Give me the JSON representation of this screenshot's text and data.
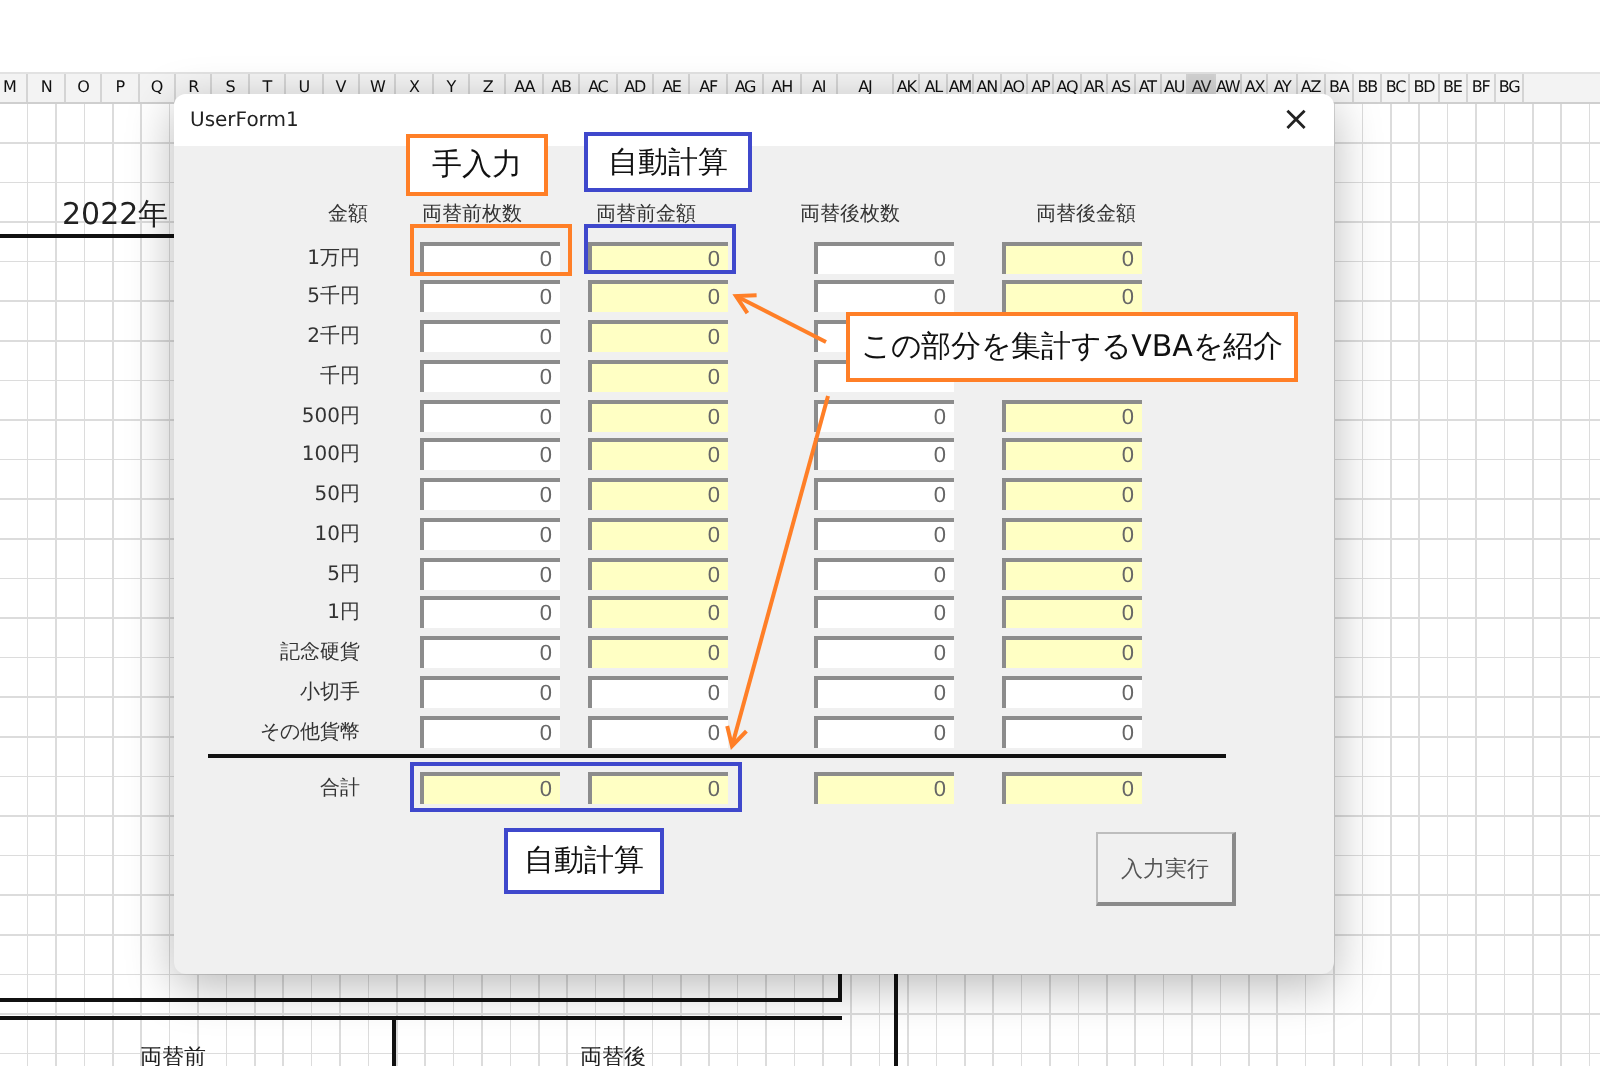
{
  "sheet": {
    "columns": [
      {
        "label": "M",
        "selected": false
      },
      {
        "label": "N",
        "selected": false
      },
      {
        "label": "O",
        "selected": false
      },
      {
        "label": "P",
        "selected": false
      },
      {
        "label": "Q",
        "selected": false
      },
      {
        "label": "R",
        "selected": false
      },
      {
        "label": "S",
        "selected": false
      },
      {
        "label": "T",
        "selected": false
      },
      {
        "label": "U",
        "selected": false
      },
      {
        "label": "V",
        "selected": false
      },
      {
        "label": "W",
        "selected": false
      },
      {
        "label": "X",
        "selected": false
      },
      {
        "label": "Y",
        "selected": false
      },
      {
        "label": "Z",
        "selected": false
      },
      {
        "label": "AA",
        "selected": false
      },
      {
        "label": "AB",
        "selected": false
      },
      {
        "label": "AC",
        "selected": false
      },
      {
        "label": "AD",
        "selected": false
      },
      {
        "label": "AE",
        "selected": false
      },
      {
        "label": "AF",
        "selected": false
      },
      {
        "label": "AG",
        "selected": false
      },
      {
        "label": "AH",
        "selected": false
      },
      {
        "label": "AI",
        "selected": false
      },
      {
        "label": "AJ",
        "selected": false
      },
      {
        "label": "AK",
        "selected": false
      },
      {
        "label": "AL",
        "selected": false
      },
      {
        "label": "AM",
        "selected": false
      },
      {
        "label": "AN",
        "selected": false
      },
      {
        "label": "AO",
        "selected": false
      },
      {
        "label": "AP",
        "selected": false
      },
      {
        "label": "AQ",
        "selected": false
      },
      {
        "label": "AR",
        "selected": false
      },
      {
        "label": "AS",
        "selected": false
      },
      {
        "label": "AT",
        "selected": false
      },
      {
        "label": "AU",
        "selected": false
      },
      {
        "label": "AV",
        "selected": true
      },
      {
        "label": "AW",
        "selected": false
      },
      {
        "label": "AX",
        "selected": false
      },
      {
        "label": "AY",
        "selected": false
      },
      {
        "label": "AZ",
        "selected": false
      },
      {
        "label": "BA",
        "selected": false
      },
      {
        "label": "BB",
        "selected": false
      },
      {
        "label": "BC",
        "selected": false
      },
      {
        "label": "BD",
        "selected": false
      },
      {
        "label": "BE",
        "selected": false
      },
      {
        "label": "BF",
        "selected": false
      },
      {
        "label": "BG",
        "selected": false
      }
    ],
    "cells": [
      {
        "text": "2022年"
      },
      {
        "text": "両替前"
      },
      {
        "text": "両替後"
      }
    ]
  },
  "dialog": {
    "title": "UserForm1",
    "close": "×",
    "headers": [
      "金額",
      "両替前枚数",
      "両替前金額",
      "両替後枚数",
      "両替後金額"
    ],
    "rows": [
      {
        "label": "1万円",
        "fields": [
          {
            "value": "0",
            "kind": "input"
          },
          {
            "value": "0",
            "kind": "auto"
          },
          {
            "value": "0",
            "kind": "input"
          },
          {
            "value": "0",
            "kind": "auto"
          }
        ]
      },
      {
        "label": "5千円",
        "fields": [
          {
            "value": "0",
            "kind": "input"
          },
          {
            "value": "0",
            "kind": "auto"
          },
          {
            "value": "0",
            "kind": "input"
          },
          {
            "value": "0",
            "kind": "auto"
          }
        ]
      },
      {
        "label": "2千円",
        "fields": [
          {
            "value": "0",
            "kind": "input"
          },
          {
            "value": "0",
            "kind": "auto"
          },
          {
            "kind": "input"
          }
        ]
      },
      {
        "label": "千円",
        "fields": [
          {
            "value": "0",
            "kind": "input"
          },
          {
            "value": "0",
            "kind": "auto"
          },
          {
            "kind": "input"
          }
        ]
      },
      {
        "label": "500円",
        "fields": [
          {
            "value": "0",
            "kind": "input"
          },
          {
            "value": "0",
            "kind": "auto"
          },
          {
            "value": "0",
            "kind": "input"
          },
          {
            "value": "0",
            "kind": "auto"
          }
        ]
      },
      {
        "label": "100円",
        "fields": [
          {
            "value": "0",
            "kind": "input"
          },
          {
            "value": "0",
            "kind": "auto"
          },
          {
            "value": "0",
            "kind": "input"
          },
          {
            "value": "0",
            "kind": "auto"
          }
        ]
      },
      {
        "label": "50円",
        "fields": [
          {
            "value": "0",
            "kind": "input"
          },
          {
            "value": "0",
            "kind": "auto"
          },
          {
            "value": "0",
            "kind": "input"
          },
          {
            "value": "0",
            "kind": "auto"
          }
        ]
      },
      {
        "label": "10円",
        "fields": [
          {
            "value": "0",
            "kind": "input"
          },
          {
            "value": "0",
            "kind": "auto"
          },
          {
            "value": "0",
            "kind": "input"
          },
          {
            "value": "0",
            "kind": "auto"
          }
        ]
      },
      {
        "label": "5円",
        "fields": [
          {
            "value": "0",
            "kind": "input"
          },
          {
            "value": "0",
            "kind": "auto"
          },
          {
            "value": "0",
            "kind": "input"
          },
          {
            "value": "0",
            "kind": "auto"
          }
        ]
      },
      {
        "label": "1円",
        "fields": [
          {
            "value": "0",
            "kind": "input"
          },
          {
            "value": "0",
            "kind": "auto"
          },
          {
            "value": "0",
            "kind": "input"
          },
          {
            "value": "0",
            "kind": "auto"
          }
        ]
      },
      {
        "label": "記念硬貨",
        "fields": [
          {
            "value": "0",
            "kind": "input"
          },
          {
            "value": "0",
            "kind": "auto"
          },
          {
            "value": "0",
            "kind": "input"
          },
          {
            "value": "0",
            "kind": "auto"
          }
        ]
      },
      {
        "label": "小切手",
        "fields": [
          {
            "value": "0",
            "kind": "input"
          },
          {
            "value": "0",
            "kind": "input"
          },
          {
            "value": "0",
            "kind": "input"
          },
          {
            "value": "0",
            "kind": "input"
          }
        ]
      },
      {
        "label": "その他貨幣",
        "fields": [
          {
            "value": "0",
            "kind": "input"
          },
          {
            "value": "0",
            "kind": "input"
          },
          {
            "value": "0",
            "kind": "input"
          },
          {
            "value": "0",
            "kind": "input"
          }
        ]
      }
    ],
    "total": {
      "label": "合計",
      "fields": [
        {
          "value": "0",
          "kind": "auto"
        },
        {
          "value": "0",
          "kind": "auto"
        },
        {
          "value": "0",
          "kind": "auto"
        },
        {
          "value": "0",
          "kind": "auto"
        }
      ]
    },
    "button": "入力実行"
  },
  "annotations": [
    {
      "text": "手入力",
      "color": "#ff7f27"
    },
    {
      "text": "自動計算",
      "color": "#3f48cc"
    },
    {
      "text": "この部分を集計するVBAを紹介",
      "color": "#ff7f27"
    },
    {
      "text": "自動計算",
      "color": "#3f48cc"
    }
  ]
}
